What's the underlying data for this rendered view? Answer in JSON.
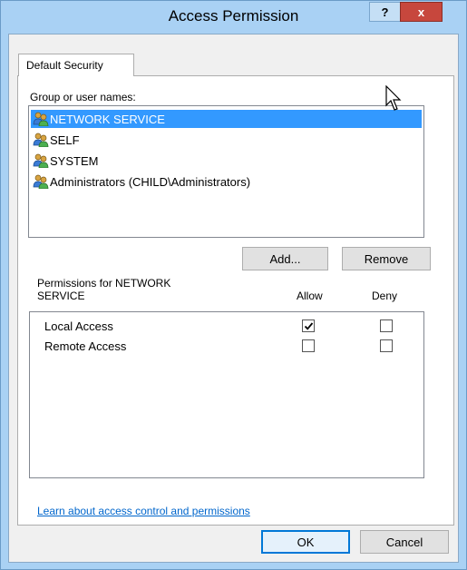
{
  "window": {
    "title": "Access Permission",
    "help_label": "?",
    "close_label": "x"
  },
  "tabs": [
    {
      "label": "Default Security",
      "selected": true
    }
  ],
  "group_section": {
    "label": "Group or user names:",
    "users": [
      {
        "name": "NETWORK SERVICE",
        "selected": true,
        "icon": "users-icon"
      },
      {
        "name": "SELF",
        "selected": false,
        "icon": "users-icon"
      },
      {
        "name": "SYSTEM",
        "selected": false,
        "icon": "users-icon"
      },
      {
        "name": "Administrators (CHILD\\Administrators)",
        "selected": false,
        "icon": "users-icon"
      }
    ],
    "add_label": "Add...",
    "remove_label": "Remove"
  },
  "permissions": {
    "label": "Permissions for NETWORK SERVICE",
    "allow_header": "Allow",
    "deny_header": "Deny",
    "rows": [
      {
        "name": "Local Access",
        "allow": true,
        "deny": false
      },
      {
        "name": "Remote Access",
        "allow": false,
        "deny": false
      }
    ]
  },
  "link": {
    "text": "Learn about access control and permissions"
  },
  "footer": {
    "ok_label": "OK",
    "cancel_label": "Cancel"
  },
  "colors": {
    "frame": "#a9d1f4",
    "close_button": "#c7473d",
    "selection": "#3399ff",
    "link": "#0066cc"
  }
}
